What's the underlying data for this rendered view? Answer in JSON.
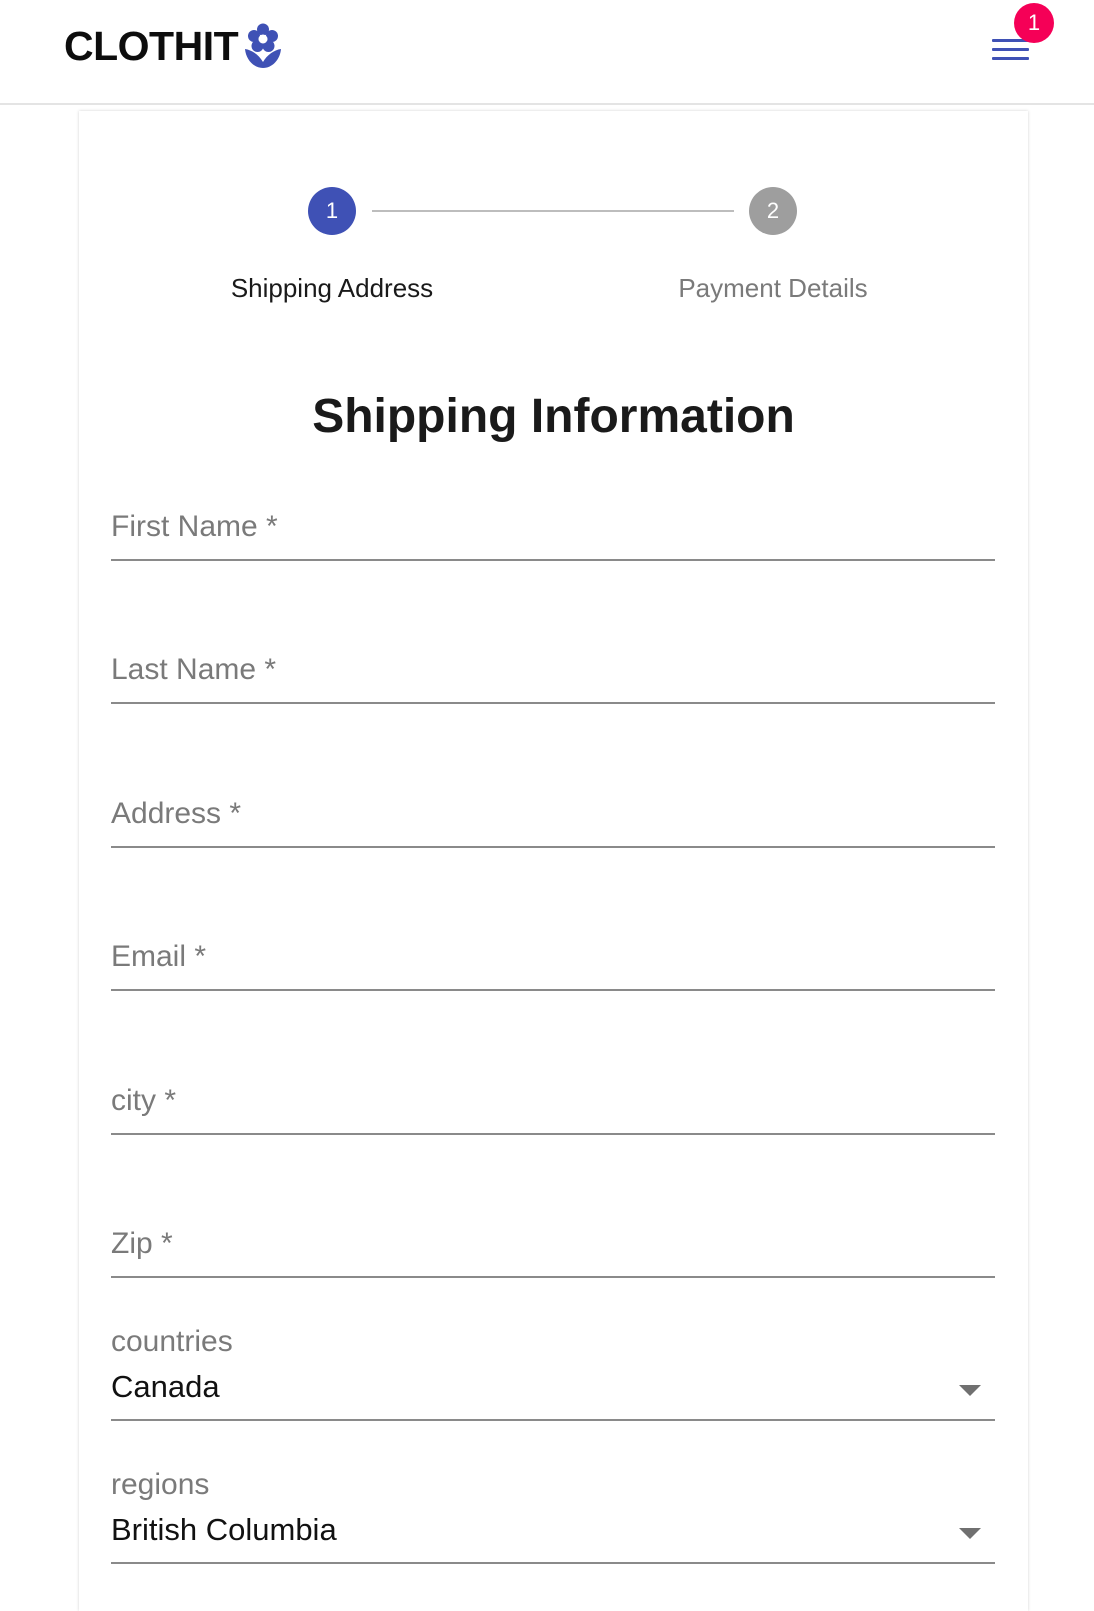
{
  "header": {
    "brand": "CLOTHIT",
    "logo_icon": "flower-icon",
    "menu_icon": "hamburger-menu-icon",
    "cart_badge": "1",
    "accent": "#3f51b5",
    "badge_color": "#f50057"
  },
  "stepper": {
    "steps": [
      {
        "number": "1",
        "label": "Shipping Address",
        "active": true
      },
      {
        "number": "2",
        "label": "Payment Details",
        "active": false
      }
    ]
  },
  "form": {
    "title": "Shipping Information",
    "fields": {
      "first_name": {
        "label": "First Name *",
        "value": ""
      },
      "last_name": {
        "label": "Last Name *",
        "value": ""
      },
      "address": {
        "label": "Address *",
        "value": ""
      },
      "email": {
        "label": "Email *",
        "value": ""
      },
      "city": {
        "label": "city *",
        "value": ""
      },
      "zip": {
        "label": "Zip *",
        "value": ""
      }
    },
    "selects": {
      "countries": {
        "label": "countries",
        "value": "Canada",
        "icon": "dropdown-arrow-icon"
      },
      "regions": {
        "label": "regions",
        "value": "British Columbia",
        "icon": "dropdown-arrow-icon"
      }
    }
  }
}
